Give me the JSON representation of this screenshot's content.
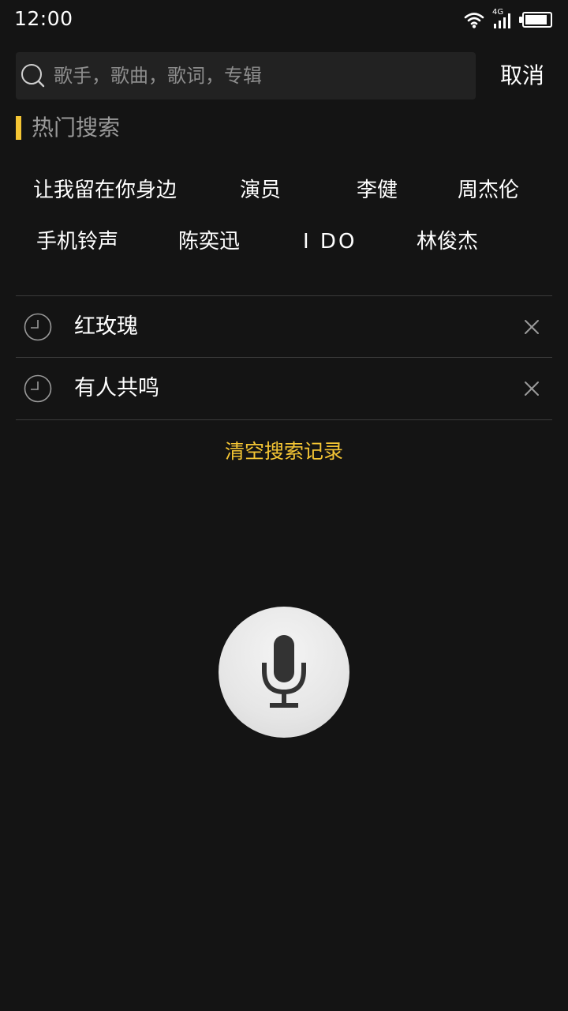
{
  "status_bar": {
    "time": "12:00",
    "network_label": "4G",
    "battery_level": 0.9
  },
  "search": {
    "placeholder": "歌手，歌曲，歌词，专辑",
    "value": "",
    "cancel_label": "取消"
  },
  "hot_search": {
    "title": "热门搜索",
    "tags": [
      "让我留在你身边",
      "演员",
      "李健",
      "周杰伦",
      "手机铃声",
      "陈奕迅",
      "I DO",
      "林俊杰"
    ]
  },
  "history": {
    "items": [
      "红玫瑰",
      "有人共鸣"
    ],
    "clear_label": "清空搜索记录"
  },
  "icons": {
    "search": "search-icon",
    "clock": "clock-icon",
    "remove": "close-icon",
    "voice": "microphone-icon",
    "wifi": "wifi-icon",
    "signal": "signal-icon",
    "battery": "battery-icon"
  },
  "colors": {
    "background": "#141414",
    "accent": "#f4c534",
    "search_box": "#222222",
    "placeholder": "#8d8d8d",
    "divider": "#3b3b3b"
  }
}
